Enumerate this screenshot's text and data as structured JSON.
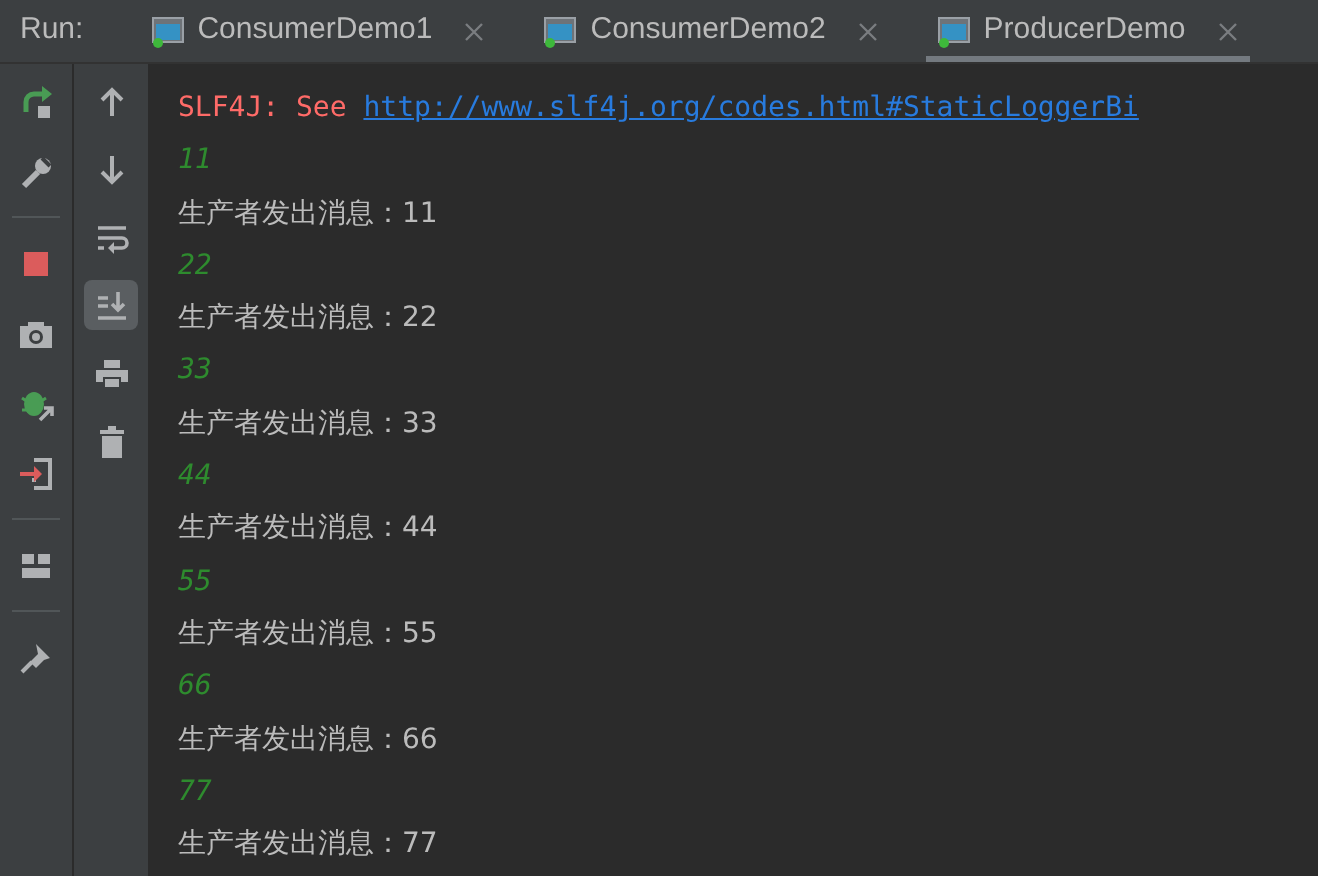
{
  "run_label": "Run:",
  "tabs": [
    {
      "label": "ConsumerDemo1",
      "selected": false
    },
    {
      "label": "ConsumerDemo2",
      "selected": false
    },
    {
      "label": "ProducerDemo",
      "selected": true
    }
  ],
  "toolbar_left": [
    {
      "kind": "rerun"
    },
    {
      "kind": "settings"
    },
    {
      "kind": "separator"
    },
    {
      "kind": "stop"
    },
    {
      "kind": "camera"
    },
    {
      "kind": "debug"
    },
    {
      "kind": "exit"
    },
    {
      "kind": "separator"
    },
    {
      "kind": "layout"
    },
    {
      "kind": "separator"
    },
    {
      "kind": "pin"
    }
  ],
  "toolbar_right": [
    {
      "kind": "up",
      "selected": false
    },
    {
      "kind": "down",
      "selected": false
    },
    {
      "kind": "wrap",
      "selected": false
    },
    {
      "kind": "scroll-end",
      "selected": true
    },
    {
      "kind": "print",
      "selected": false
    },
    {
      "kind": "trash",
      "selected": false
    }
  ],
  "console": [
    {
      "kind": "error",
      "text": "SLF4J: See ",
      "link": "http://www.slf4j.org/codes.html#StaticLoggerBi"
    },
    {
      "kind": "log",
      "text": "11"
    },
    {
      "kind": "out",
      "text": "生产者发出消息：11"
    },
    {
      "kind": "log",
      "text": "22"
    },
    {
      "kind": "out",
      "text": "生产者发出消息：22"
    },
    {
      "kind": "log",
      "text": "33"
    },
    {
      "kind": "out",
      "text": "生产者发出消息：33"
    },
    {
      "kind": "log",
      "text": "44"
    },
    {
      "kind": "out",
      "text": "生产者发出消息：44"
    },
    {
      "kind": "log",
      "text": "55"
    },
    {
      "kind": "out",
      "text": "生产者发出消息：55"
    },
    {
      "kind": "log",
      "text": "66"
    },
    {
      "kind": "out",
      "text": "生产者发出消息：66"
    },
    {
      "kind": "log",
      "text": "77"
    },
    {
      "kind": "out",
      "text": "生产者发出消息：77"
    }
  ]
}
